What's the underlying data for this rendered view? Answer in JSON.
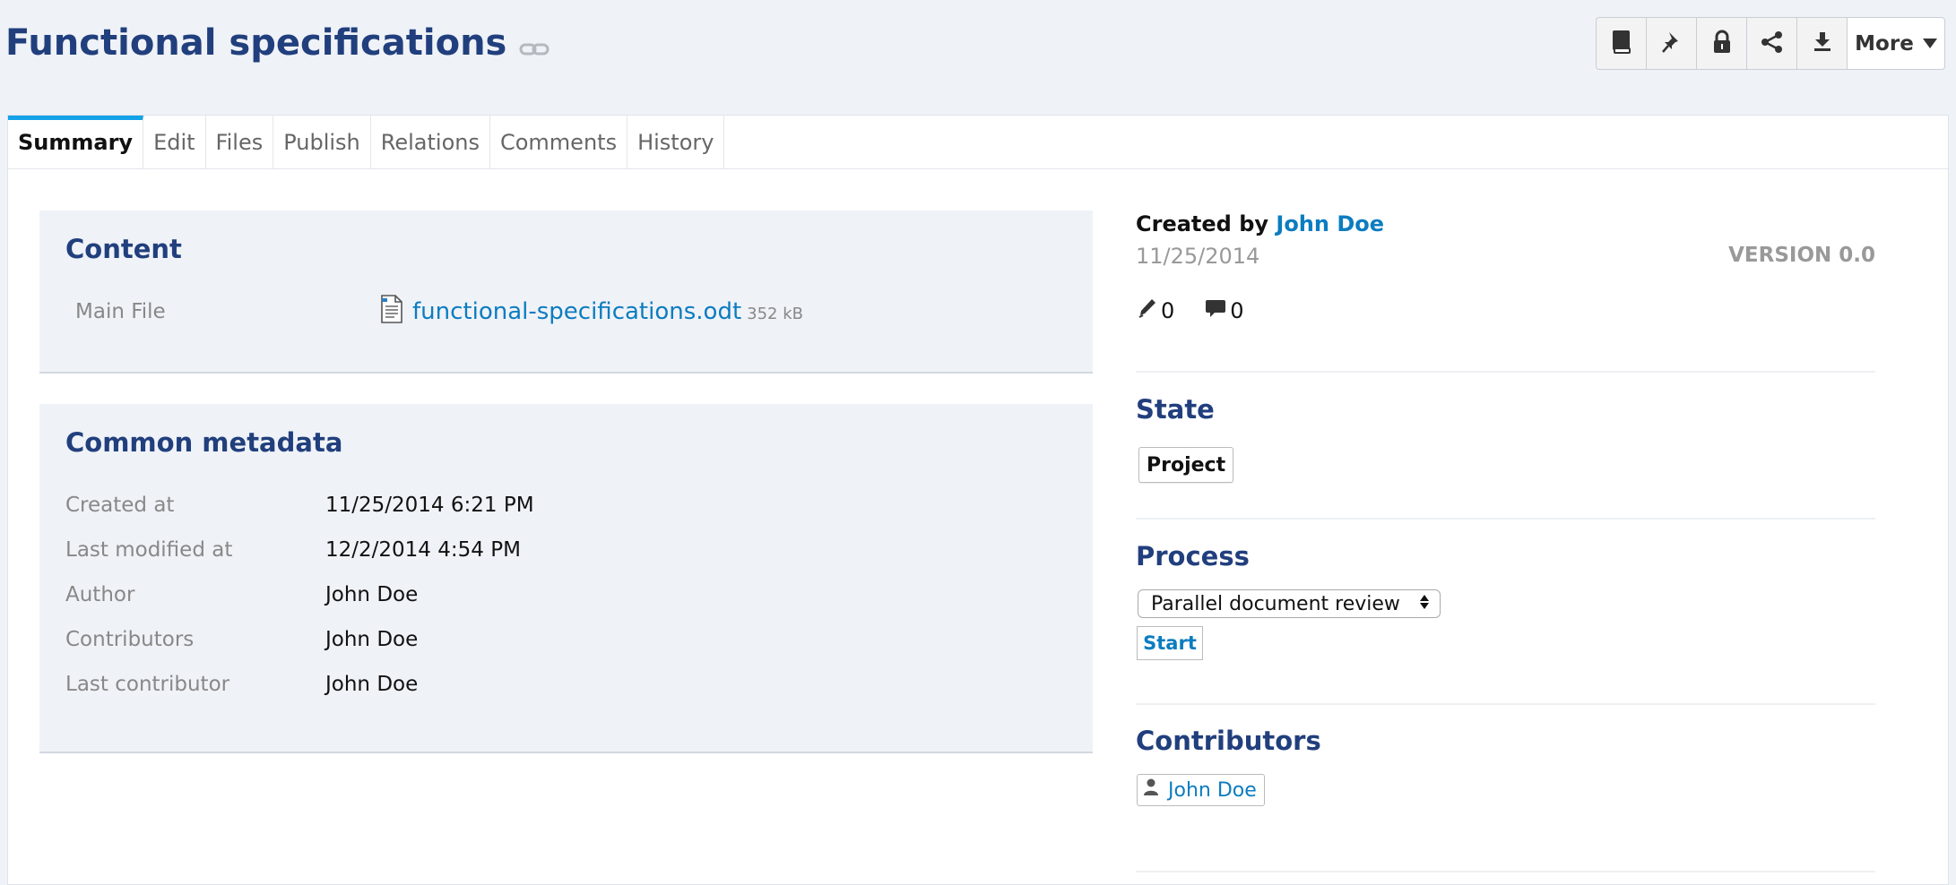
{
  "page": {
    "title": "Functional specifications"
  },
  "toolbar": {
    "buttons": [
      {
        "name": "book-icon"
      },
      {
        "name": "pin-icon"
      },
      {
        "name": "lock-icon"
      },
      {
        "name": "share-icon"
      },
      {
        "name": "download-icon"
      }
    ],
    "more_label": "More"
  },
  "tabs": [
    {
      "label": "Summary",
      "active": true
    },
    {
      "label": "Edit"
    },
    {
      "label": "Files"
    },
    {
      "label": "Publish"
    },
    {
      "label": "Relations"
    },
    {
      "label": "Comments"
    },
    {
      "label": "History"
    }
  ],
  "content_card": {
    "title": "Content",
    "main_file_label": "Main File",
    "file_name": "functional-specifications.odt",
    "file_size": "352 kB"
  },
  "metadata_card": {
    "title": "Common metadata",
    "rows": [
      {
        "label": "Created at",
        "value": "11/25/2014 6:21 PM"
      },
      {
        "label": "Last modified at",
        "value": "12/2/2014 4:54 PM"
      },
      {
        "label": "Author",
        "value": "John Doe"
      },
      {
        "label": "Contributors",
        "value": "John Doe"
      },
      {
        "label": "Last contributor",
        "value": "John Doe"
      }
    ]
  },
  "summary": {
    "created_by_label": "Created by",
    "created_by": "John Doe",
    "created_date": "11/25/2014",
    "version": "VERSION 0.0",
    "edits_count": "0",
    "comments_count": "0"
  },
  "state": {
    "title": "State",
    "value": "Project"
  },
  "process": {
    "title": "Process",
    "selected": "Parallel document review",
    "start_label": "Start"
  },
  "contributors": {
    "title": "Contributors",
    "users": [
      "John Doe"
    ]
  },
  "colors": {
    "heading": "#213f7d",
    "link": "#0c7cc0",
    "active_tab_accent": "#14a2e8",
    "background": "#eff2f7"
  }
}
